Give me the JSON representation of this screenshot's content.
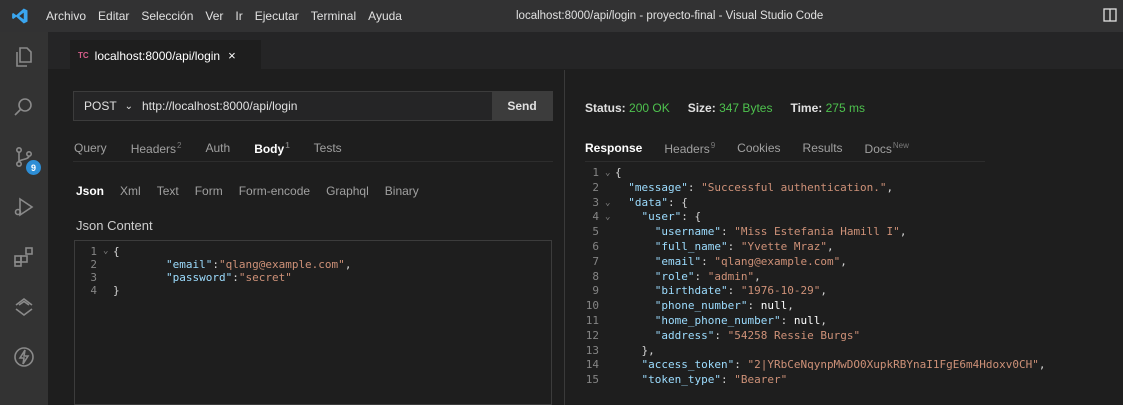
{
  "titlebar": {
    "menu": [
      "Archivo",
      "Editar",
      "Selección",
      "Ver",
      "Ir",
      "Ejecutar",
      "Terminal",
      "Ayuda"
    ],
    "window_title": "localhost:8000/api/login - proyecto-final - Visual Studio Code"
  },
  "activity": {
    "source_control_badge": "9"
  },
  "tab": {
    "icon_text": "TC",
    "label": "localhost:8000/api/login",
    "close": "×"
  },
  "request": {
    "method": "POST",
    "url": "http://localhost:8000/api/login",
    "send_label": "Send",
    "tabs": [
      {
        "label": "Query",
        "count": ""
      },
      {
        "label": "Headers",
        "count": "2"
      },
      {
        "label": "Auth",
        "count": ""
      },
      {
        "label": "Body",
        "count": "1"
      },
      {
        "label": "Tests",
        "count": ""
      }
    ],
    "body_tabs": [
      "Json",
      "Xml",
      "Text",
      "Form",
      "Form-encode",
      "Graphql",
      "Binary"
    ],
    "json_content_label": "Json Content",
    "editor_lines": [
      {
        "n": "1",
        "fold": "⌄",
        "text": "{"
      },
      {
        "n": "2",
        "fold": "",
        "text": "        \"email\":\"qlang@example.com\","
      },
      {
        "n": "3",
        "fold": "",
        "text": "        \"password\":\"secret\""
      },
      {
        "n": "4",
        "fold": "",
        "text": "}"
      }
    ]
  },
  "response": {
    "status_label": "Status:",
    "status_value": "200 OK",
    "size_label": "Size:",
    "size_value": "347 Bytes",
    "time_label": "Time:",
    "time_value": "275 ms",
    "tabs": [
      {
        "label": "Response",
        "count": ""
      },
      {
        "label": "Headers",
        "count": "9"
      },
      {
        "label": "Cookies",
        "count": ""
      },
      {
        "label": "Results",
        "count": ""
      },
      {
        "label": "Docs",
        "count": "New"
      }
    ],
    "lines": [
      {
        "n": "1",
        "fold": "⌄",
        "text": "{"
      },
      {
        "n": "2",
        "fold": "",
        "text": "  \"message\": \"Successful authentication.\","
      },
      {
        "n": "3",
        "fold": "⌄",
        "text": "  \"data\": {"
      },
      {
        "n": "4",
        "fold": "⌄",
        "text": "    \"user\": {"
      },
      {
        "n": "5",
        "fold": "",
        "text": "      \"username\": \"Miss Estefania Hamill I\","
      },
      {
        "n": "6",
        "fold": "",
        "text": "      \"full_name\": \"Yvette Mraz\","
      },
      {
        "n": "7",
        "fold": "",
        "text": "      \"email\": \"qlang@example.com\","
      },
      {
        "n": "8",
        "fold": "",
        "text": "      \"role\": \"admin\","
      },
      {
        "n": "9",
        "fold": "",
        "text": "      \"birthdate\": \"1976-10-29\","
      },
      {
        "n": "10",
        "fold": "",
        "text": "      \"phone_number\": null,"
      },
      {
        "n": "11",
        "fold": "",
        "text": "      \"home_phone_number\": null,"
      },
      {
        "n": "12",
        "fold": "",
        "text": "      \"address\": \"54258 Ressie Burgs\""
      },
      {
        "n": "13",
        "fold": "",
        "text": "    },"
      },
      {
        "n": "14",
        "fold": "",
        "text": "    \"access_token\": \"2|YRbCeNqynpMwDO0XupkRBYnaI1FgE6m4Hdoxv0CH\","
      },
      {
        "n": "15",
        "fold": "",
        "text": "    \"token_type\": \"Bearer\""
      }
    ]
  },
  "colors": {
    "accent_green": "#4ec24e",
    "string": "#ce9178",
    "key": "#9cdcfe",
    "tab_icon": "#d75e8b",
    "badge": "#2d8ed6"
  }
}
